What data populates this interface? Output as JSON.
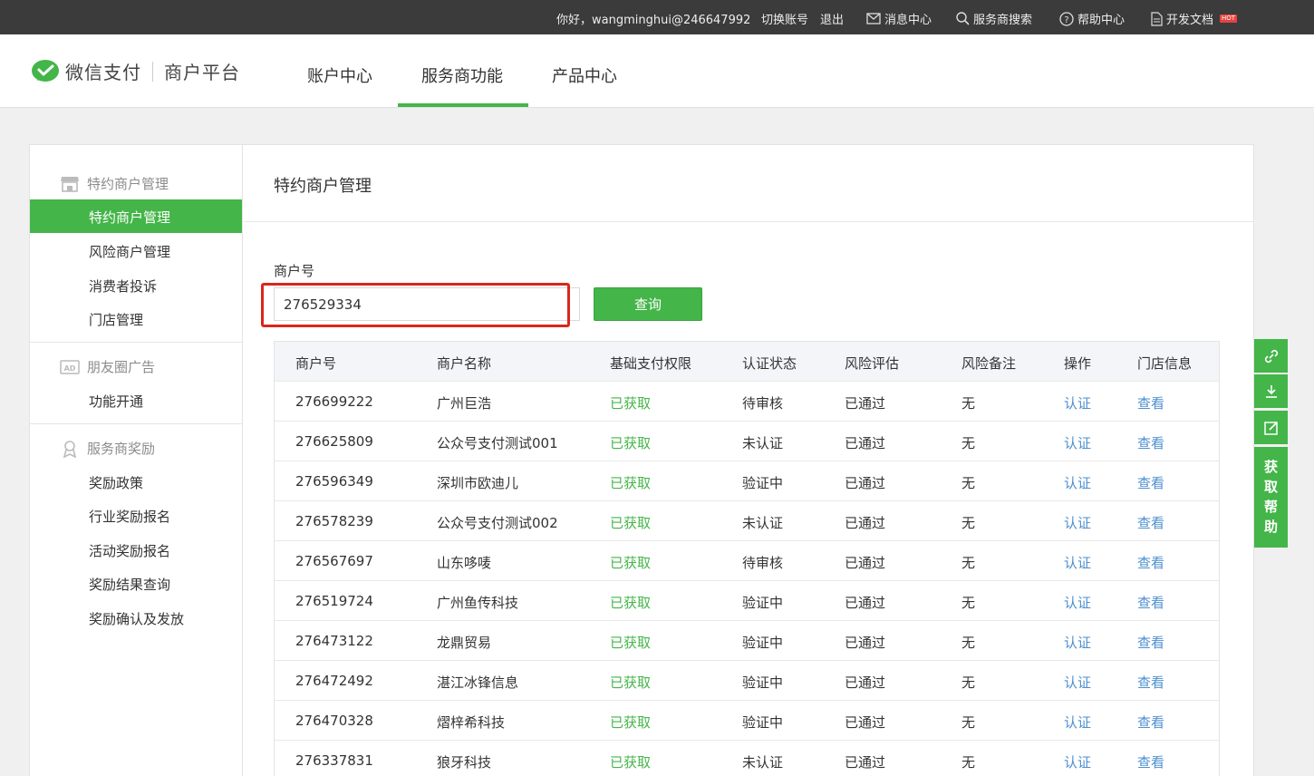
{
  "topbar": {
    "greeting": "你好，wangminghui@246647992",
    "switch_account": "切换账号",
    "logout": "退出",
    "messages": "消息中心",
    "provider_search": "服务商搜索",
    "help_center": "帮助中心",
    "dev_docs": "开发文档",
    "hot_badge": "HOT"
  },
  "header": {
    "logo": "微信支付",
    "platform": "商户平台",
    "nav": [
      "账户中心",
      "服务商功能",
      "产品中心"
    ],
    "active_nav": "服务商功能"
  },
  "sidebar": {
    "groups": [
      {
        "title": "特约商户管理",
        "icon": "store-icon",
        "items": [
          "特约商户管理",
          "风险商户管理",
          "消费者投诉",
          "门店管理"
        ]
      },
      {
        "title": "朋友圈广告",
        "icon": "ad-icon",
        "items": [
          "功能开通"
        ]
      },
      {
        "title": "服务商奖励",
        "icon": "reward-icon",
        "items": [
          "奖励政策",
          "行业奖励报名",
          "活动奖励报名",
          "奖励结果查询",
          "奖励确认及发放"
        ]
      }
    ],
    "active_item": "特约商户管理"
  },
  "content": {
    "title": "特约商户管理",
    "merchant_id_label": "商户号",
    "merchant_id_value": "276529334",
    "query_button": "查询"
  },
  "table": {
    "columns": [
      "商户号",
      "商户名称",
      "基础支付权限",
      "认证状态",
      "风险评估",
      "风险备注",
      "操作",
      "门店信息"
    ],
    "rows": [
      [
        "276699222",
        "广州巨浩",
        "已获取",
        "待审核",
        "已通过",
        "无",
        "认证",
        "查看"
      ],
      [
        "276625809",
        "公众号支付测试001",
        "已获取",
        "未认证",
        "已通过",
        "无",
        "认证",
        "查看"
      ],
      [
        "276596349",
        "深圳市欧迪儿",
        "已获取",
        "验证中",
        "已通过",
        "无",
        "认证",
        "查看"
      ],
      [
        "276578239",
        "公众号支付测试002",
        "已获取",
        "未认证",
        "已通过",
        "无",
        "认证",
        "查看"
      ],
      [
        "276567697",
        "山东哆唛",
        "已获取",
        "待审核",
        "已通过",
        "无",
        "认证",
        "查看"
      ],
      [
        "276519724",
        "广州鱼传科技",
        "已获取",
        "验证中",
        "已通过",
        "无",
        "认证",
        "查看"
      ],
      [
        "276473122",
        "龙鼎贸易",
        "已获取",
        "验证中",
        "已通过",
        "无",
        "认证",
        "查看"
      ],
      [
        "276472492",
        "湛江冰锋信息",
        "已获取",
        "验证中",
        "已通过",
        "无",
        "认证",
        "查看"
      ],
      [
        "276470328",
        "熠梓希科技",
        "已获取",
        "验证中",
        "已通过",
        "无",
        "认证",
        "查看"
      ],
      [
        "276337831",
        "狼牙科技",
        "已获取",
        "未认证",
        "已通过",
        "无",
        "认证",
        "查看"
      ]
    ]
  },
  "right_tools": {
    "icons": [
      "link-icon",
      "download-icon",
      "edit-icon"
    ],
    "help_label": [
      "获",
      "取",
      "帮",
      "助"
    ]
  },
  "colors": {
    "brand_green": "#44b549",
    "link_blue": "#4d8fcf",
    "highlight_red": "#d9261c",
    "topbar_bg": "#3b3b3b"
  }
}
